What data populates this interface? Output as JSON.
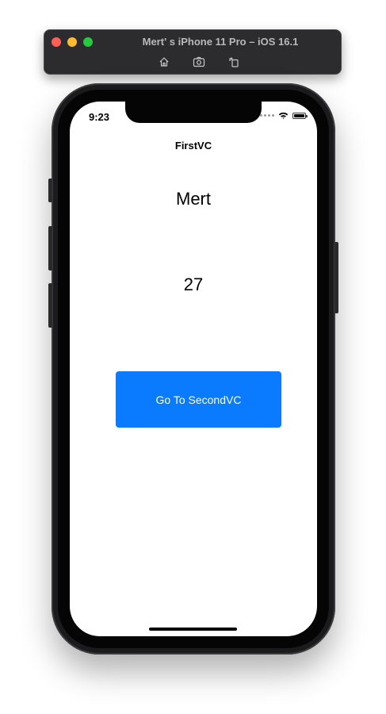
{
  "simulator": {
    "title": "Mert' s iPhone 11 Pro – iOS 16.1",
    "tools": [
      {
        "icon": "home-icon"
      },
      {
        "icon": "screenshot-icon"
      },
      {
        "icon": "rotate-icon"
      }
    ]
  },
  "status_bar": {
    "time": "9:23",
    "battery_level": 1.0
  },
  "nav": {
    "title": "FirstVC"
  },
  "content": {
    "name": "Mert",
    "age": "27",
    "button_label": "Go To SecondVC"
  },
  "colors": {
    "button_bg": "#0a7aff",
    "close": "#ff5f57",
    "minimize": "#febc2e",
    "maximize": "#28c840"
  }
}
